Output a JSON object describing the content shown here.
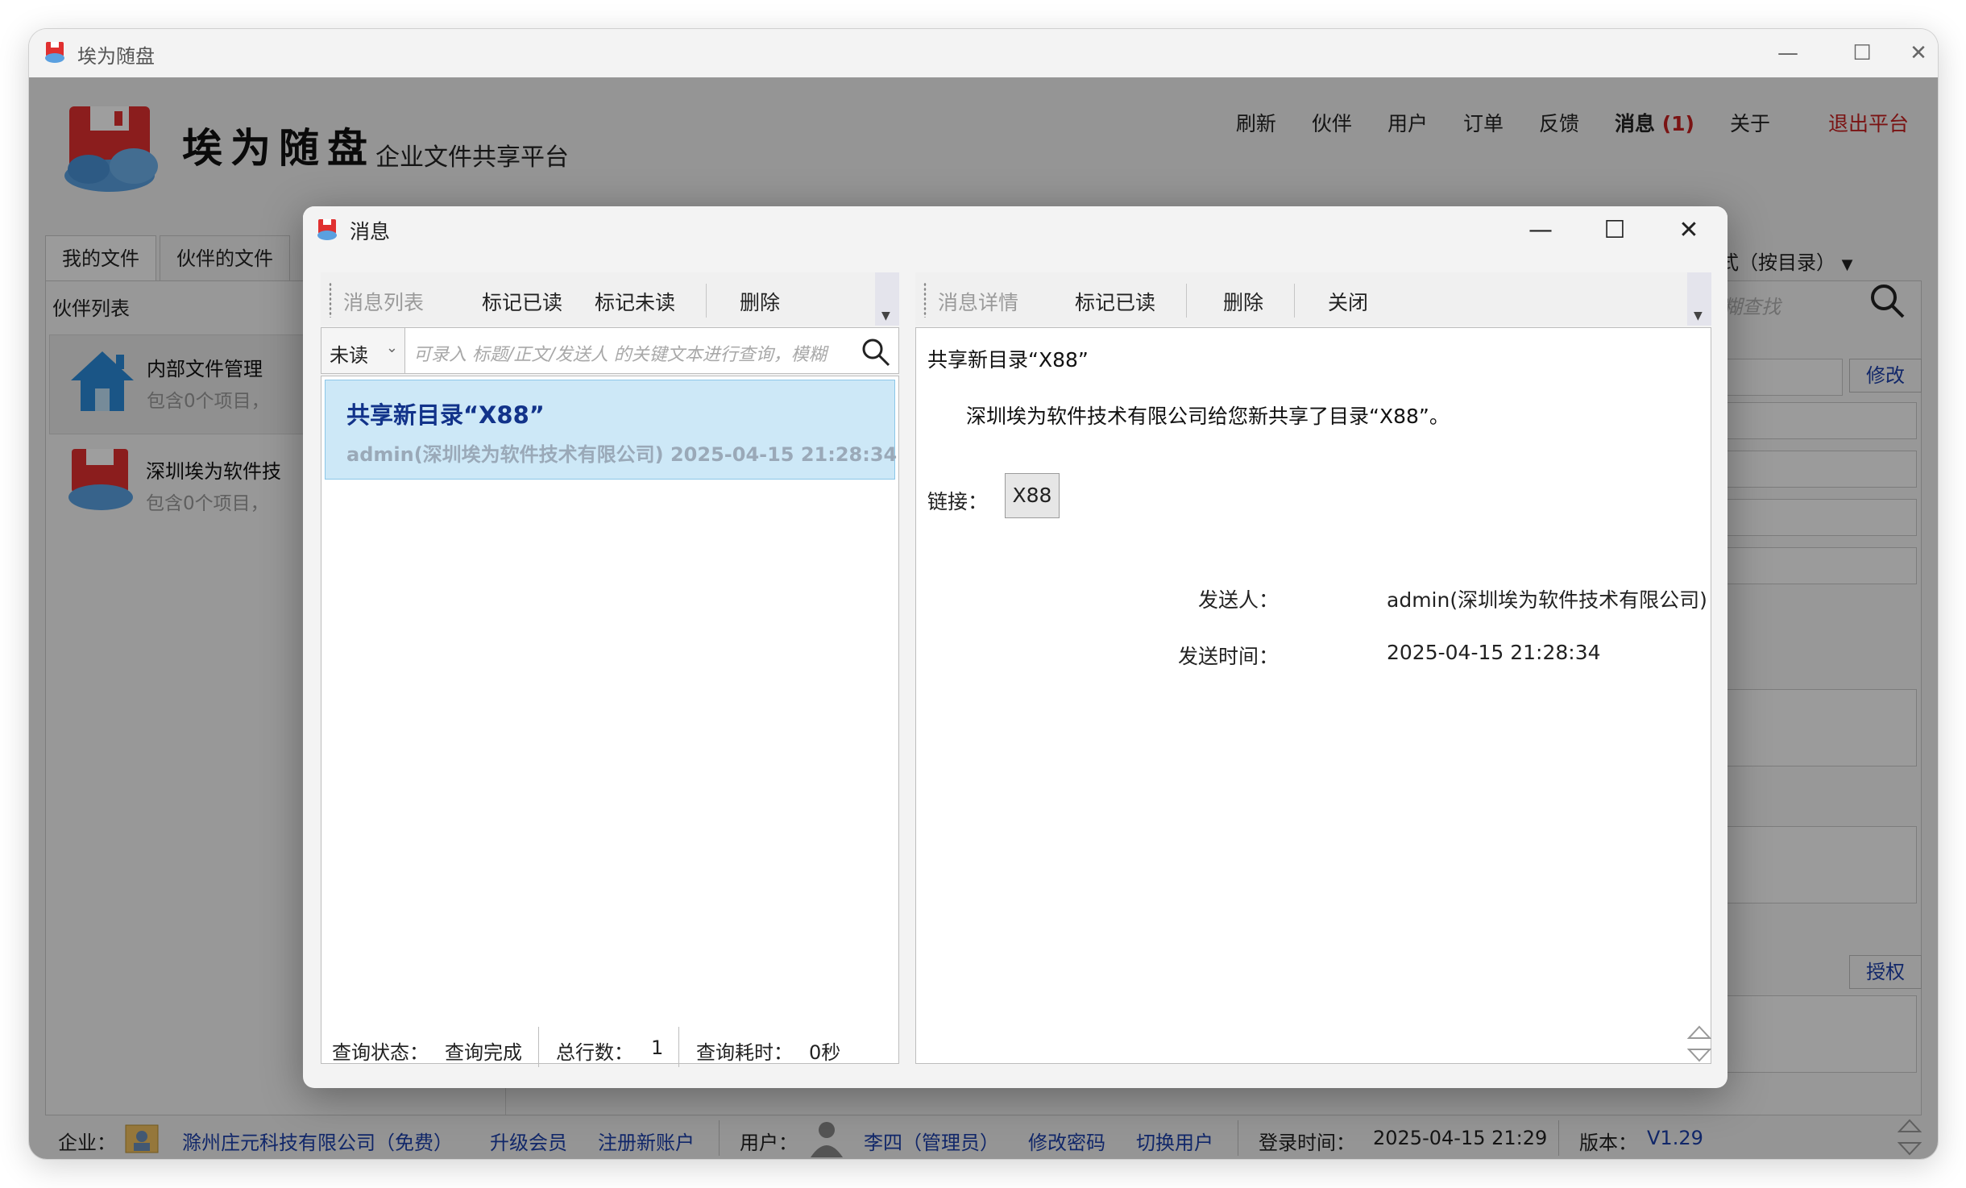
{
  "window": {
    "title": "埃为随盘"
  },
  "header": {
    "brand_name": "埃为随盘",
    "brand_subtitle": "企业文件共享平台",
    "nav": [
      "刷新",
      "伙伴",
      "用户",
      "订单",
      "反馈"
    ],
    "messages_label": "消息",
    "messages_count": "(1)",
    "about_label": "关于",
    "logout_label": "退出平台"
  },
  "tabs": [
    "我的文件",
    "伙伴的文件"
  ],
  "sort_label": "示方式（按目录）",
  "partners": {
    "header": "伙伴列表",
    "items": [
      {
        "name": "内部文件管理",
        "count": "包含0个项目，"
      },
      {
        "name": "深圳埃为软件技",
        "count": "包含0个项目，"
      }
    ]
  },
  "right_panel": {
    "search_placeholder": "部分进行模糊查找",
    "modify_label": "修改",
    "authorize_label": "授权"
  },
  "statusbar": {
    "company_label": "企业：",
    "company_name": "滁州庄元科技有限公司（免费）",
    "upgrade": "升级会员",
    "register": "注册新账户",
    "user_label": "用户：",
    "user_name": "李四（管理员）",
    "change_password": "修改密码",
    "switch_user": "切换用户",
    "login_time_label": "登录时间：",
    "login_time": "2025-04-15 21:29",
    "version_label": "版本：",
    "version": "V1.29"
  },
  "dialog": {
    "title": "消息",
    "left_toolbar": {
      "section": "消息列表",
      "mark_read": "标记已读",
      "mark_unread": "标记未读",
      "delete": "删除"
    },
    "right_toolbar": {
      "section": "消息详情",
      "mark_read": "标记已读",
      "delete": "删除",
      "close": "关闭"
    },
    "filter": {
      "selected": "未读",
      "placeholder": "可录入 标题/正文/发送人 的关键文本进行查询，模糊"
    },
    "messages": [
      {
        "title": "共享新目录“X88”",
        "meta": "admin(深圳埃为软件技术有限公司)   2025-04-15 21:28:34"
      }
    ],
    "detail": {
      "title": "共享新目录“X88”",
      "body": "深圳埃为软件技术有限公司给您新共享了目录“X88”。",
      "link_label": "链接：",
      "link_value": "X88",
      "sender_label": "发送人：",
      "sender": "admin(深圳埃为软件技术有限公司)",
      "time_label": "发送时间：",
      "time": "2025-04-15 21:28:34"
    },
    "status": {
      "state_label": "查询状态：",
      "state": "查询完成",
      "total_label": "总行数：",
      "total": "1",
      "elapsed_label": "查询耗时：",
      "elapsed": "0秒"
    }
  },
  "colors": {
    "accent": "#1c3faa",
    "alert": "#c62020",
    "selected_row": "#cde8f7"
  },
  "icons": [
    "app-logo-icon",
    "house-icon",
    "cloud-disk-icon",
    "search-icon",
    "user-avatar-icon",
    "company-icon",
    "minimize-icon",
    "maximize-icon",
    "close-icon"
  ]
}
